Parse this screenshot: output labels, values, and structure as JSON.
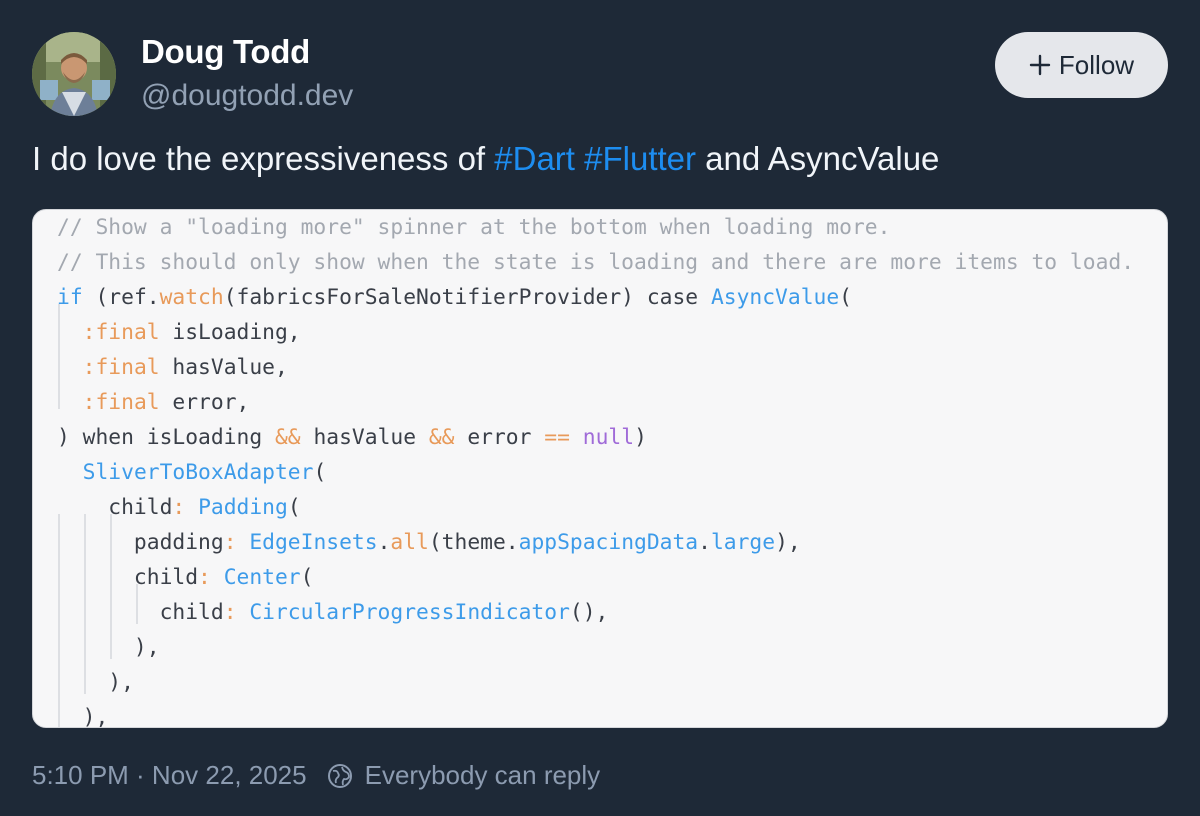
{
  "author": {
    "name": "Doug Todd",
    "handle": "@dougtodd.dev"
  },
  "follow": {
    "icon": "plus-icon",
    "label": "Follow"
  },
  "post": {
    "text_before": "I do love the expressiveness of ",
    "tags": [
      "#Dart",
      "#Flutter"
    ],
    "text_after": " and AsyncValue"
  },
  "code_image": {
    "lines": [
      "// Show a \"loading more\" spinner at the bottom when loading more.",
      "// This should only show when the state is loading and there are more items to load.",
      "if (ref.watch(fabricsForSaleNotifierProvider) case AsyncValue(",
      "  :final isLoading,",
      "  :final hasValue,",
      "  :final error,",
      ") when isLoading && hasValue && error == null)",
      "  SliverToBoxAdapter(",
      "    child: Padding(",
      "      padding: EdgeInsets.all(theme.appSpacingData.large),",
      "      child: Center(",
      "        child: CircularProgressIndicator(),",
      "      ),",
      "    ),",
      "  ),"
    ]
  },
  "footer": {
    "timestamp": "5:10 PM · Nov 22, 2025",
    "reply_icon": "globe-icon",
    "reply_setting": "Everybody can reply"
  },
  "colors": {
    "background": "#1e2937",
    "link": "#1d8df0",
    "muted": "#92a1b4",
    "code_background": "#f7f7f8"
  }
}
